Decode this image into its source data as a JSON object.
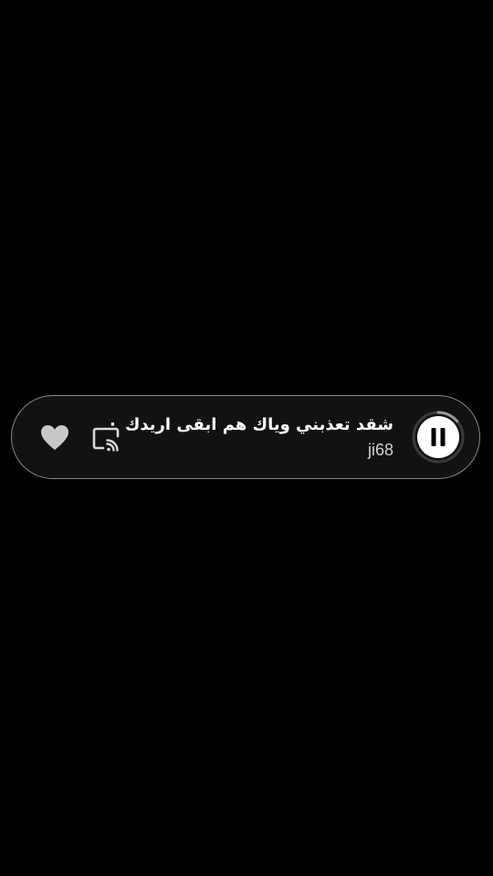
{
  "player": {
    "track_title": "شقد تعذبني وياك هم ابقى اريدك",
    "separator": "·",
    "artist": "ji68",
    "playback_state": "playing",
    "progress_fraction": 0.14,
    "liked": true
  },
  "icons": {
    "like": "heart-icon",
    "cast": "cast-icon",
    "pause": "pause-icon"
  },
  "colors": {
    "background": "#000000",
    "bar_background": "#121212",
    "bar_border": "#8a8a8a",
    "icon": "#c8c8c8",
    "progress_track": "#3a3a3a",
    "progress_fill": "#9a9a9a",
    "button_fill": "#ffffff"
  }
}
